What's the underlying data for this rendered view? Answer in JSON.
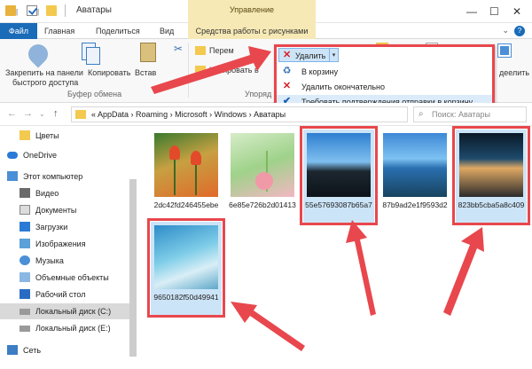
{
  "window": {
    "title": "Аватары",
    "context_tab": "Управление"
  },
  "tabs": {
    "file": "Файл",
    "home": "Главная",
    "share": "Поделиться",
    "view": "Вид",
    "tools": "Средства работы с рисунками"
  },
  "ribbon": {
    "pin_label_1": "Закрепить на панели",
    "pin_label_2": "быстрого доступа",
    "copy_label": "Копировать",
    "paste_label": "Встав",
    "clipboard_group": "Буфер обмена",
    "move_label": "Перем",
    "copyto_label": "Копировать в",
    "organize_group": "Упоряд",
    "rename_label": "Удалить",
    "select_label": "деелить"
  },
  "delete_menu": {
    "button_label": "Удалить",
    "items": [
      {
        "label": "В корзину",
        "icon": "recycle-bin-icon",
        "checked": false
      },
      {
        "label": "Удалить окончательно",
        "icon": "x-icon",
        "checked": false
      },
      {
        "label": "Требовать подтверждения отправки в корзину",
        "icon": "check-icon",
        "checked": true
      }
    ]
  },
  "address": {
    "prefix": "«",
    "path": "AppData  ›  Roaming  ›  Microsoft  ›  Windows  ›  Аватары",
    "search_placeholder": "Поиск: Аватары"
  },
  "sidebar": {
    "items": [
      {
        "label": "Цветы",
        "icon": "folder-icon"
      },
      {
        "label": "OneDrive",
        "icon": "onedrive-icon"
      },
      {
        "label": "Этот компьютер",
        "icon": "computer-icon"
      },
      {
        "label": "Видео",
        "icon": "video-icon"
      },
      {
        "label": "Документы",
        "icon": "documents-icon"
      },
      {
        "label": "Загрузки",
        "icon": "downloads-icon"
      },
      {
        "label": "Изображения",
        "icon": "pictures-icon"
      },
      {
        "label": "Музыка",
        "icon": "music-icon"
      },
      {
        "label": "Объемные объекты",
        "icon": "3d-objects-icon"
      },
      {
        "label": "Рабочий стол",
        "icon": "desktop-icon"
      },
      {
        "label": "Локальный диск (C:)",
        "icon": "drive-icon"
      },
      {
        "label": "Локальный диск (E:)",
        "icon": "drive-icon"
      },
      {
        "label": "Сеть",
        "icon": "network-icon"
      }
    ]
  },
  "files": [
    {
      "name": "2dc42fd246455ebe",
      "selected": false
    },
    {
      "name": "6e85e726b2d01413",
      "selected": false
    },
    {
      "name": "55e57693087b65a7",
      "selected": true
    },
    {
      "name": "87b9ad2e1f9593d2",
      "selected": false
    },
    {
      "name": "823bb5cba5a8c409",
      "selected": true
    },
    {
      "name": "9650182f50d49941",
      "selected": true
    }
  ],
  "colors": {
    "accent": "#1a6bb8",
    "highlight": "#e8474d",
    "context_tab": "#f7e9b5"
  }
}
